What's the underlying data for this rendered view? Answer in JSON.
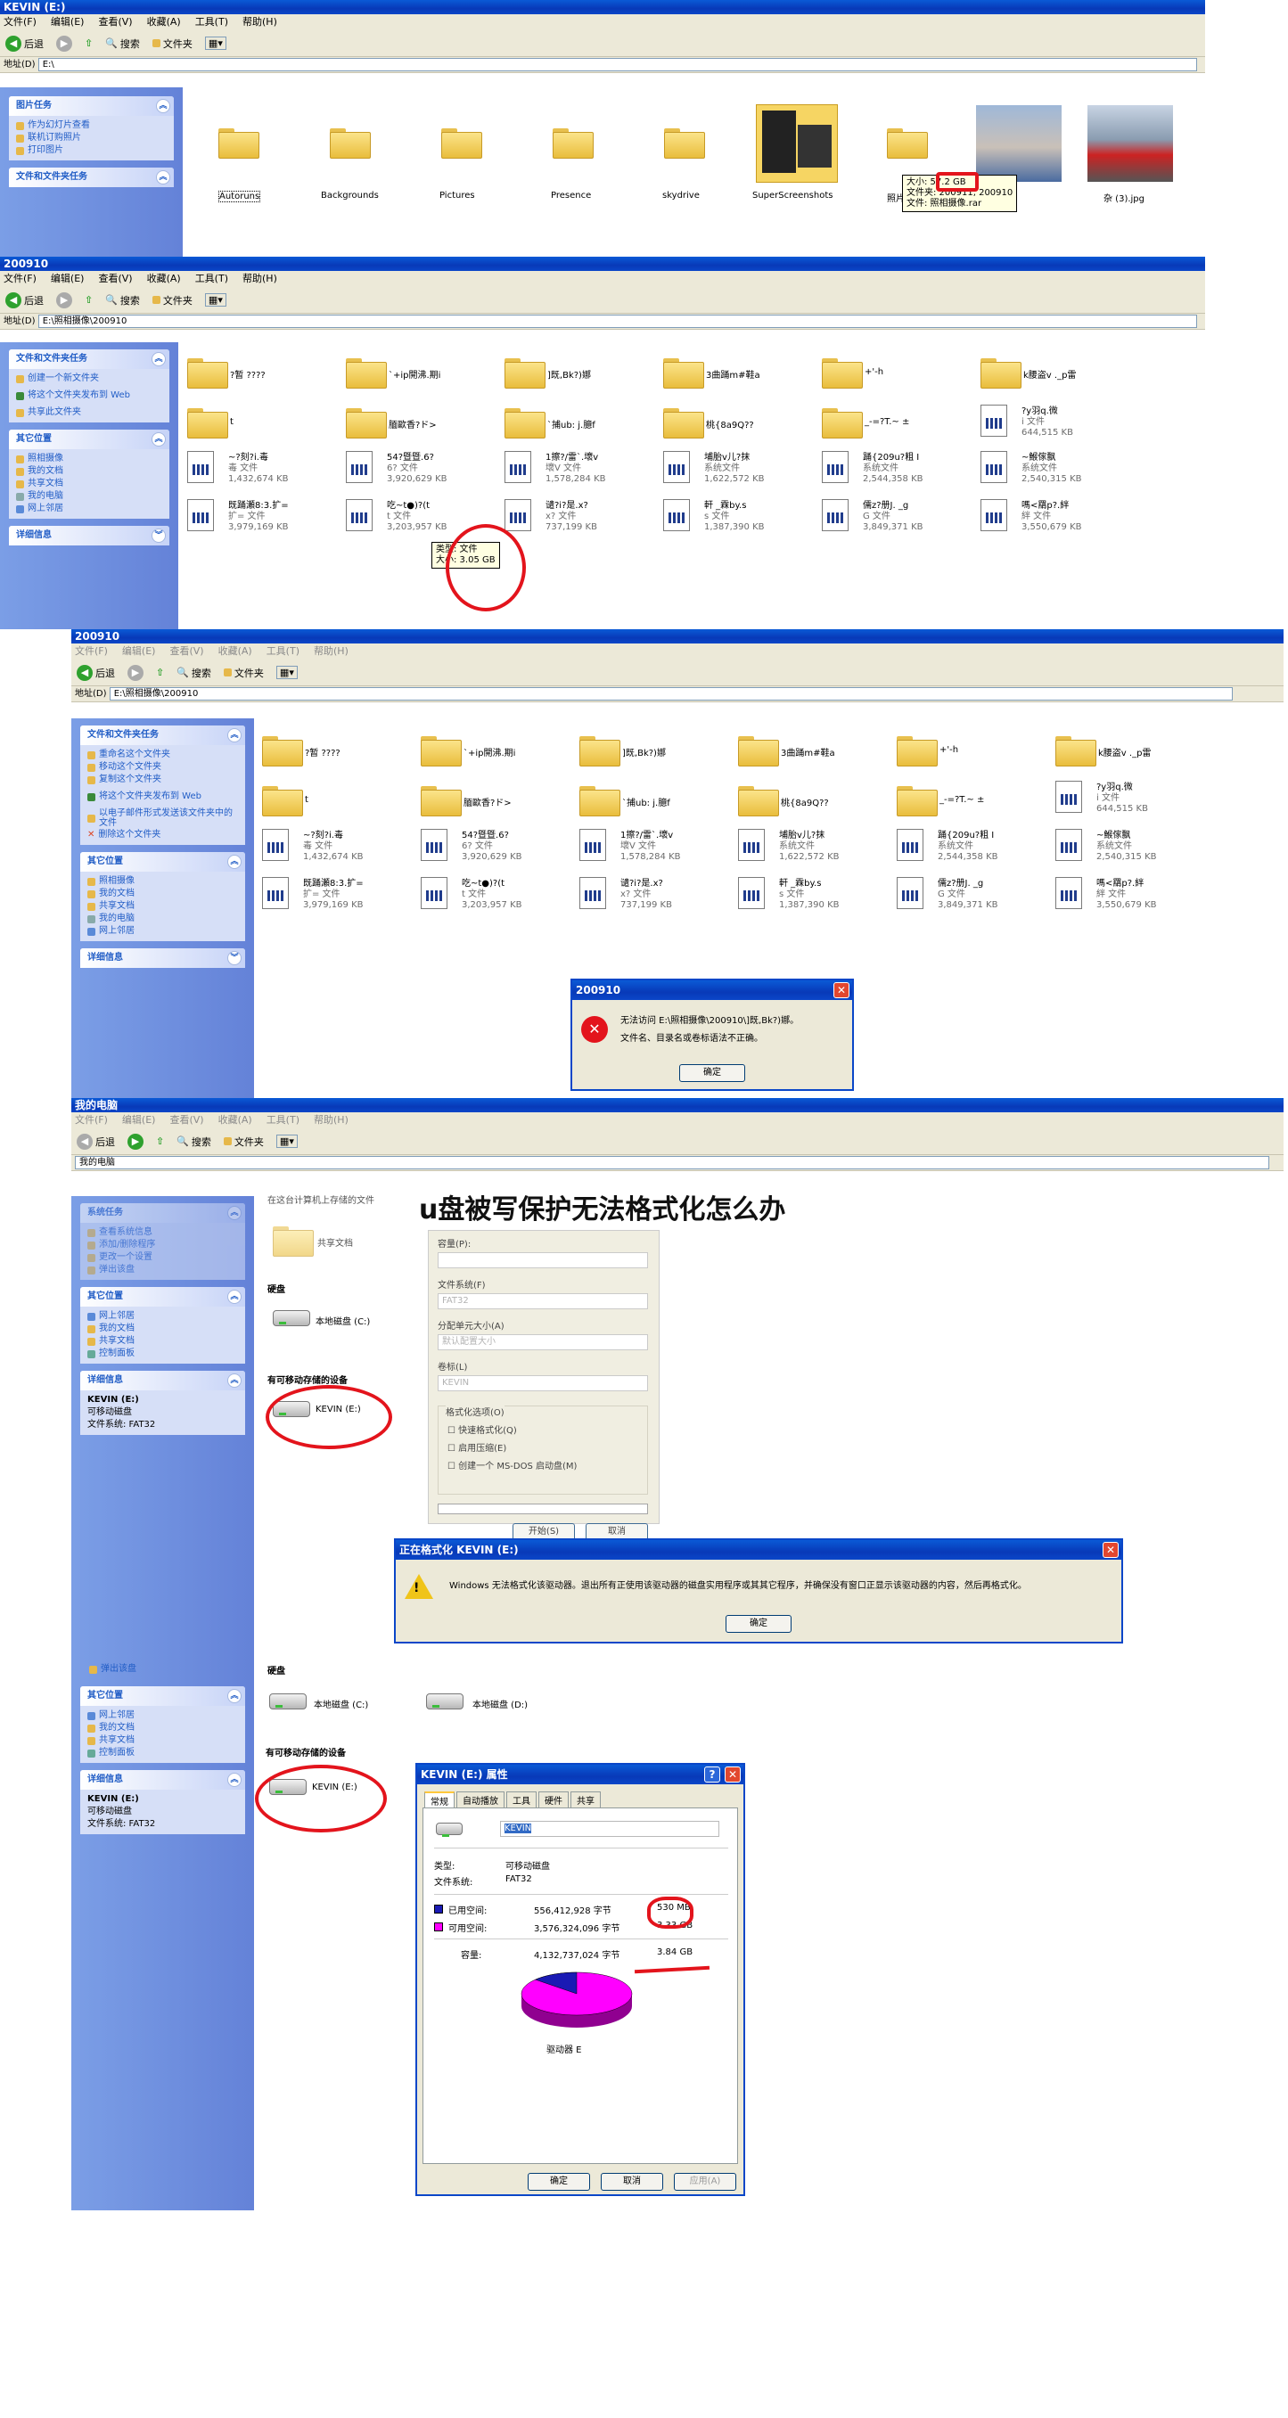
{
  "w1": {
    "title": "KEVIN (E:)",
    "menu": [
      "文件(F)",
      "编辑(E)",
      "查看(V)",
      "收藏(A)",
      "工具(T)",
      "帮助(H)"
    ],
    "toolbar": {
      "back": "后退",
      "search": "搜索",
      "folders": "文件夹"
    },
    "address_label": "地址(D)",
    "address": "E:\\",
    "picture_tasks": {
      "title": "图片任务",
      "items": [
        "作为幻灯片查看",
        "联机订购照片",
        "打印图片"
      ]
    },
    "file_tasks_title": "文件和文件夹任务",
    "folders": [
      "Autoruns",
      "Backgrounds",
      "Pictures",
      "Presence",
      "skydrive",
      "SuperScreenshots",
      "照片",
      "杂 (3).jpg"
    ],
    "tooltip": {
      "line1": "大小: 57.2 GB",
      "line2": "文件夹: 200911, 200910",
      "line3": "文件: 照相摄像.rar"
    }
  },
  "w2": {
    "title": "200910",
    "menu": [
      "文件(F)",
      "编辑(E)",
      "查看(V)",
      "收藏(A)",
      "工具(T)",
      "帮助(H)"
    ],
    "toolbar": {
      "back": "后退",
      "search": "搜索",
      "folders": "文件夹"
    },
    "address_label": "地址(D)",
    "address": "E:\\照相摄像\\200910",
    "tasks": {
      "title": "文件和文件夹任务",
      "items": [
        "创建一个新文件夹",
        "将这个文件夹发布到 Web",
        "共享此文件夹"
      ]
    },
    "other": {
      "title": "其它位置",
      "items": [
        "照相摄像",
        "我的文档",
        "共享文档",
        "我的电脑",
        "网上邻居"
      ]
    },
    "details_title": "详细信息",
    "folders_row1": [
      "?暂 ????",
      "`+ip開沸.期i",
      "]既,Bk?)娜",
      "3曲踊m#鞋a",
      "+'-h",
      "k腰盗v ._p雷"
    ],
    "folders_row2": [
      "t",
      "腼歐香?ド>",
      "`捕ub: j.臆f",
      "桃{8a9Q??",
      "_-=?T.~ ±"
    ],
    "files": [
      {
        "name": "?y羽q.微",
        "type": "i 文件",
        "size": "644,515 KB"
      },
      {
        "name": "~?刻?i.毒",
        "type": "毒 文件",
        "size": "1,432,674 KB"
      },
      {
        "name": "54?暨暨.6?",
        "type": "6? 文件",
        "size": "3,920,629 KB"
      },
      {
        "name": "1擦?/雷`.壞v",
        "type": "壞V 文件",
        "size": "1,578,284 KB"
      },
      {
        "name": "埔胎v儿?抹",
        "type": "系统文件",
        "size": "1,622,572 KB"
      },
      {
        "name": "踊{209u?粗 I",
        "type": "系统文件",
        "size": "2,544,358 KB"
      },
      {
        "name": "~鯸傢飘",
        "type": "系统文件",
        "size": "2,540,315 KB"
      },
      {
        "name": "既踊瀬8:3.扩=",
        "type": "扩= 文件",
        "size": "3,979,169 KB"
      },
      {
        "name": "吃~t●)?(t",
        "type": "t 文件",
        "size": "3,203,957 KB"
      },
      {
        "name": "谴?i?是.x?",
        "type": "x? 文件",
        "size": "737,199 KB"
      },
      {
        "name": "軒 _霖by.s",
        "type": "s 文件",
        "size": "1,387,390 KB"
      },
      {
        "name": "儒z?册J. _g",
        "type": "G 文件",
        "size": "3,849,371 KB"
      },
      {
        "name": "嗎<羂p?.絆",
        "type": "絆 文件",
        "size": "3,550,679 KB"
      }
    ],
    "tooltip": {
      "line1": "类型: 文件",
      "line2": "大小: 3.05 GB"
    }
  },
  "w3": {
    "title": "200910",
    "menu": [
      "文件(F)",
      "编辑(E)",
      "查看(V)",
      "收藏(A)",
      "工具(T)",
      "帮助(H)"
    ],
    "toolbar": {
      "back": "后退",
      "search": "搜索",
      "folders": "文件夹"
    },
    "address_label": "地址(D)",
    "address": "E:\\照相摄像\\200910",
    "tasks": {
      "title": "文件和文件夹任务",
      "items": [
        "重命名这个文件夹",
        "移动这个文件夹",
        "复制这个文件夹",
        "将这个文件夹发布到 Web",
        "以电子邮件形式发送该文件夹中的文件",
        "删除这个文件夹"
      ]
    },
    "other": {
      "title": "其它位置",
      "items": [
        "照相摄像",
        "我的文档",
        "共享文档",
        "我的电脑",
        "网上邻居"
      ]
    },
    "details_title": "详细信息",
    "error": {
      "title": "200910",
      "line1": "无法访问 E:\\照相摄像\\200910\\]既,Bk?)娜。",
      "line2": "文件名、目录名或卷标语法不正确。",
      "ok": "确定"
    }
  },
  "w4": {
    "title": "我的电脑",
    "address": "我的电脑",
    "headline": "u盘被写保护无法格式化怎么办",
    "system_tasks": {
      "title": "系统任务",
      "items": [
        "查看系统信息",
        "添加/删除程序",
        "更改一个设置",
        "弹出该盘"
      ]
    },
    "other": {
      "title": "其它位置",
      "items": [
        "网上邻居",
        "我的文档",
        "共享文档",
        "控制面板"
      ]
    },
    "details": {
      "title": "详细信息",
      "name": "KEVIN (E:)",
      "type": "可移动磁盘",
      "fs": "文件系统: FAT32"
    },
    "stored_header": "在这台计算机上存储的文件",
    "shared_docs": "共享文档",
    "hdd_header": "硬盘",
    "local_c": "本地磁盘 (C:)",
    "removable_header": "有可移动存储的设备",
    "kevin": "KEVIN (E:)",
    "format": {
      "capacity": "容量(P):",
      "fs_label": "文件系统(F)",
      "fs": "FAT32",
      "alloc_label": "分配单元大小(A)",
      "alloc": "默认配置大小",
      "vol_label": "卷标(L)",
      "vol": "KEVIN",
      "opts": "格式化选项(O)",
      "o1": "快速格式化(Q)",
      "o2": "启用压缩(E)",
      "o3": "创建一个 MS-DOS 启动盘(M)",
      "start": "开始(S)",
      "close": "取消"
    },
    "warn": {
      "title": "正在格式化 KEVIN (E:)",
      "msg": "Windows 无法格式化该驱动器。退出所有正使用该驱动器的磁盘实用程序或其其它程序，并确保没有窗口正显示该驱动器的内容，然后再格式化。",
      "ok": "确定"
    }
  },
  "w5": {
    "eject": "弹出该盘",
    "hdd_header": "硬盘",
    "local_c": "本地磁盘 (C:)",
    "local_d": "本地磁盘 (D:)",
    "removable_header": "有可移动存储的设备",
    "kevin": "KEVIN (E:)",
    "other": {
      "title": "其它位置",
      "items": [
        "网上邻居",
        "我的文档",
        "共享文档",
        "控制面板"
      ]
    },
    "details": {
      "title": "详细信息",
      "name": "KEVIN (E:)",
      "type": "可移动磁盘",
      "fs": "文件系统: FAT32"
    },
    "props": {
      "title": "KEVIN (E:) 属性",
      "tabs": [
        "常规",
        "自动播放",
        "工具",
        "硬件",
        "共享"
      ],
      "name": "KEVIN",
      "type_label": "类型:",
      "type": "可移动磁盘",
      "fs_label": "文件系统:",
      "fs": "FAT32",
      "used_label": "已用空间:",
      "used_bytes": "556,412,928 字节",
      "used_h": "530 MB",
      "free_label": "可用空间:",
      "free_bytes": "3,576,324,096 字节",
      "free_h": "3.33 GB",
      "cap_label": "容量:",
      "cap_bytes": "4,132,737,024 字节",
      "cap_h": "3.84 GB",
      "drive": "驱动器 E",
      "ok": "确定",
      "cancel": "取消",
      "apply": "应用(A)",
      "used_color": "#1a1ab4",
      "free_color": "#ff00ff"
    }
  }
}
